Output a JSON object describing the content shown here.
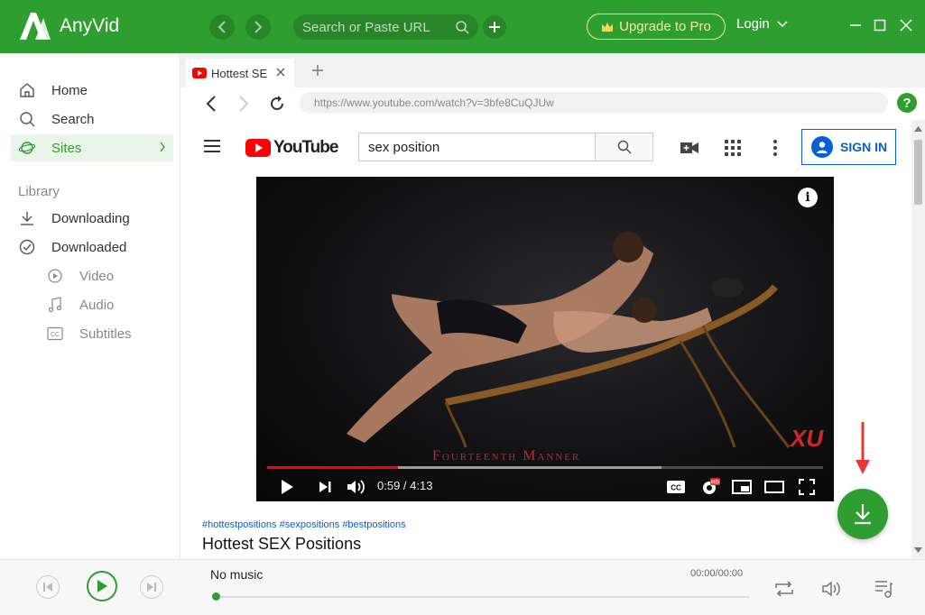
{
  "app": {
    "name": "AnyVid",
    "url_placeholder": "Search or Paste URL",
    "upgrade_label": "Upgrade to Pro",
    "login_label": "Login",
    "accent_color": "#2f9e31"
  },
  "sidebar": {
    "items": [
      {
        "label": "Home",
        "icon": "home-icon"
      },
      {
        "label": "Search",
        "icon": "search-icon"
      },
      {
        "label": "Sites",
        "icon": "planet-icon",
        "active": true
      }
    ],
    "library_label": "Library",
    "library_items": [
      {
        "label": "Downloading",
        "icon": "download-icon"
      },
      {
        "label": "Downloaded",
        "icon": "check-circle-icon"
      }
    ],
    "sub_items": [
      {
        "label": "Video",
        "icon": "play-circle-icon"
      },
      {
        "label": "Audio",
        "icon": "music-note-icon"
      },
      {
        "label": "Subtitles",
        "icon": "cc-icon"
      }
    ]
  },
  "browser": {
    "tab_title": "Hottest SE",
    "address": "https://www.youtube.com/watch?v=3bfe8CuQJUw",
    "help_label": "?"
  },
  "youtube": {
    "search_value": "sex position",
    "sign_in_label": "SIGN IN",
    "logo_text": "YouTube",
    "player": {
      "time_label": "0:59 / 4:13",
      "played_fraction": 0.235,
      "loaded_fraction": 0.71,
      "watermark_text": "Fourteenth Manner",
      "watermark_logo": "XU"
    },
    "hashtags": "#hottestpositions #sexpositions #bestpositions",
    "video_title": "Hottest SEX Positions"
  },
  "music_player": {
    "title": "No music",
    "time": "00:00/00:00",
    "progress_fraction": 0
  }
}
